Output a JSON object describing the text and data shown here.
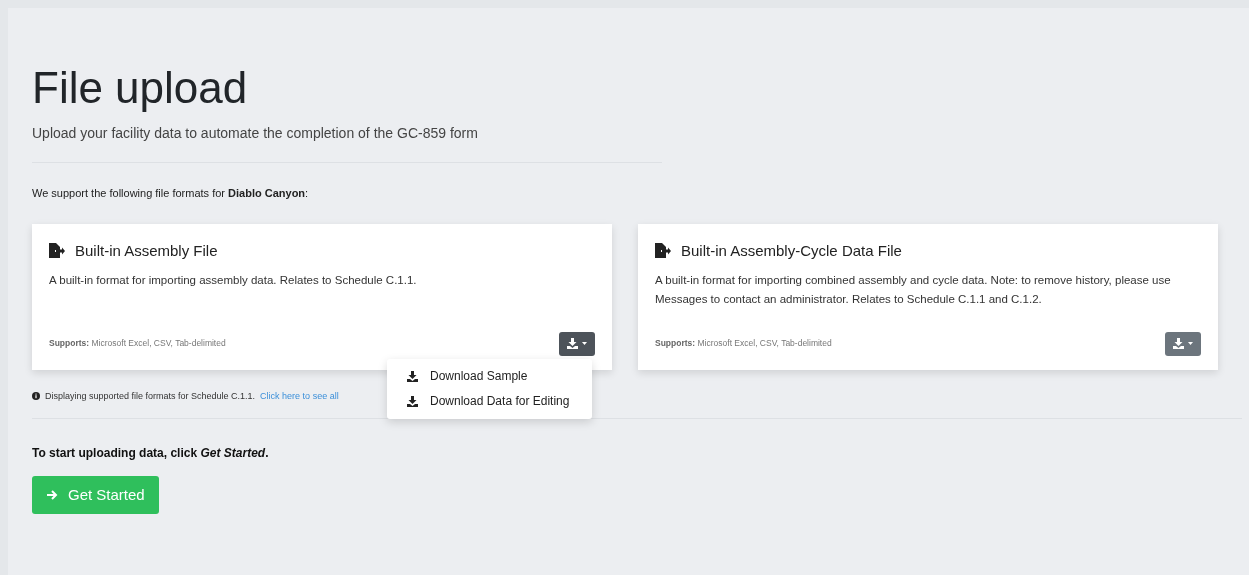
{
  "page": {
    "title": "File upload",
    "subtitle": "Upload your facility data to automate the completion of the GC-859 form"
  },
  "intro": "We support the following file formats for **Diablo Canyon**:",
  "cards": [
    {
      "title": "Built-in Assembly File",
      "description": "A built-in format for importing assembly data. Relates to Schedule C.1.1.",
      "supports_label": "Supports:",
      "supports": "Microsoft Excel, CSV, Tab-delimited",
      "expanded": true,
      "menu": [
        "Download Sample",
        "Download Data for Editing"
      ]
    },
    {
      "title": "Built-in Assembly-Cycle Data File",
      "description": "A built-in format for importing combined assembly and cycle data. Note: to remove history, please use Messages to contact an administrator. Relates to Schedule C.1.1 and C.1.2.",
      "supports_label": "Supports:",
      "supports": "Microsoft Excel, CSV, Tab-delimited",
      "expanded": false
    }
  ],
  "info": {
    "text": "Displaying supported file formats for Schedule C.1.1.",
    "link": "Click here to see all"
  },
  "start": {
    "text": "To start uploading data, click *Get Started*.",
    "button": "Get Started"
  }
}
